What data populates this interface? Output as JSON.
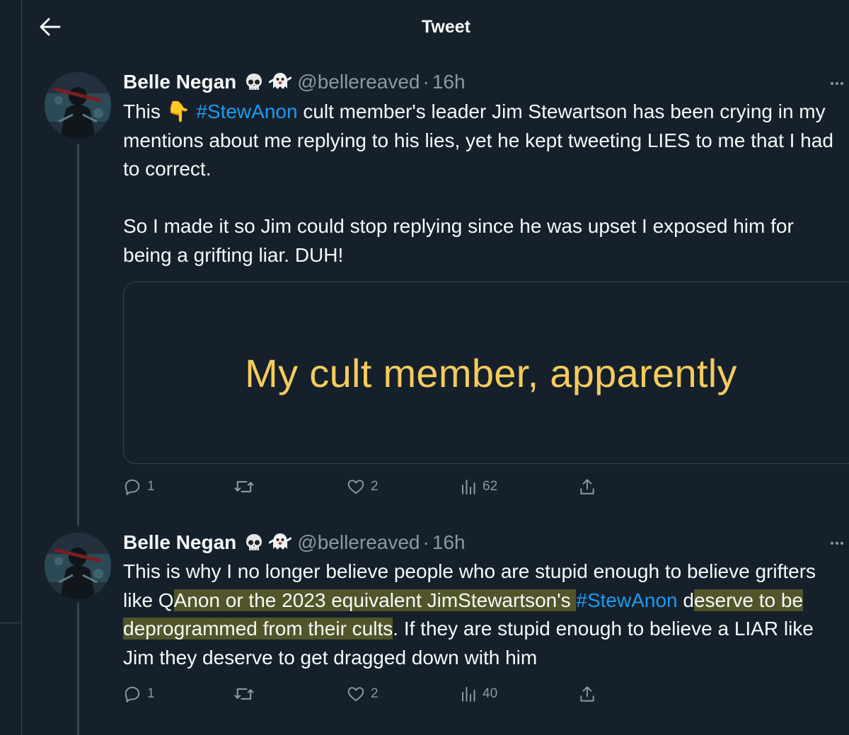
{
  "header": {
    "title": "Tweet"
  },
  "tweets": [
    {
      "name": "Belle Negan",
      "emojis": "💀👻",
      "handle": "@bellereaved",
      "dot": "·",
      "time": "16h",
      "text_parts": {
        "p1a": "This 👇 ",
        "p1_hashtag": "#StewAnon",
        "p1b": " cult member's leader Jim Stewartson has been crying in my mentions about me replying to his lies, yet he kept tweeting LIES to me that I had to correct.",
        "p2": "So I made it so Jim could stop replying since he was upset I exposed him for being a grifting liar. DUH!"
      },
      "card_text": "My cult member, apparently",
      "replies": "1",
      "likes": "2",
      "views": "62"
    },
    {
      "name": "Belle Negan",
      "emojis": "💀👻",
      "handle": "@bellereaved",
      "dot": "·",
      "time": "16h",
      "text_parts": {
        "a": "This is why I no longer believe people who are stupid enough to believe grifters like Q",
        "b": "Anon or the 2023 equivalent JimStewartson's ",
        "hashtag": "#StewAnon",
        "c": "d",
        "d": "eserve to be deprogrammed from their cults",
        "e": ". If they are stupid enough to believe a LIAR like Jim they deserve to get dragged down with him"
      },
      "replies": "1",
      "likes": "2",
      "views": "40"
    }
  ],
  "colors": {
    "background": "#15202b",
    "text": "#f7f9f9",
    "muted": "#8b98a5",
    "link": "#1d9bf0",
    "card_text": "#f5cb5c",
    "highlight": "#9b9628"
  },
  "icons": [
    "back-arrow-icon",
    "skull-icon",
    "ghost-icon",
    "more-icon",
    "reply-icon",
    "retweet-icon",
    "like-icon",
    "views-icon",
    "share-icon"
  ]
}
